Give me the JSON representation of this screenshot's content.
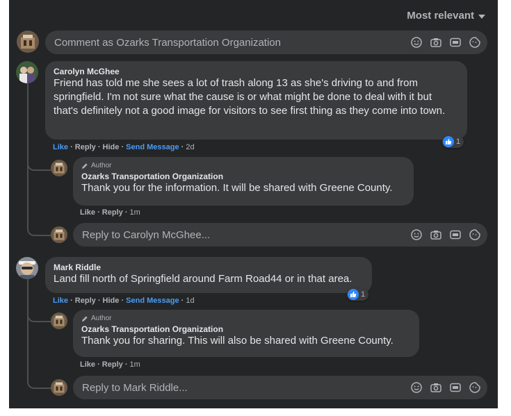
{
  "sort_label": "Most relevant",
  "composer": {
    "placeholder": "Comment as Ozarks Transportation Organization"
  },
  "comments": [
    {
      "author": "Carolyn McGhee",
      "text": "Friend has told me she sees a lot of trash along 13 as she's driving to and from springfield. I'm not sure what the cause is or what might be done to deal with it but that's definitely not a good image for visitors to see first thing as they come into town.",
      "actions": {
        "like": "Like",
        "reply": "Reply",
        "hide": "Hide",
        "send": "Send Message",
        "time": "2d"
      },
      "reactions": "1",
      "reply": {
        "badge": "Author",
        "author": "Ozarks Transportation Organization",
        "text": "Thank you for the information. It will be shared with Greene County.",
        "actions": {
          "like": "Like",
          "reply": "Reply",
          "time": "1m"
        }
      },
      "reply_placeholder": "Reply to Carolyn McGhee..."
    },
    {
      "author": "Mark Riddle",
      "text": "Land fill north of Springfield around Farm Road44 or in that area.",
      "actions": {
        "like": "Like",
        "reply": "Reply",
        "hide": "Hide",
        "send": "Send Message",
        "time": "1d"
      },
      "reactions": "1",
      "reply": {
        "badge": "Author",
        "author": "Ozarks Transportation Organization",
        "text": "Thank you for sharing. This will also be shared with Greene County.",
        "actions": {
          "like": "Like",
          "reply": "Reply",
          "time": "1m"
        }
      },
      "reply_placeholder": "Reply to Mark Riddle..."
    }
  ],
  "icons": [
    "emoji-icon",
    "camera-icon",
    "gif-icon",
    "sticker-icon",
    "thumbs-up-icon",
    "pencil-icon",
    "caret-down-icon"
  ],
  "colors": {
    "panel": "#242526",
    "bubble": "#3a3b3c",
    "link": "#4b9cf5",
    "like": "#2d88ff",
    "text": "#e4e6eb",
    "muted": "#b0b3b8"
  }
}
